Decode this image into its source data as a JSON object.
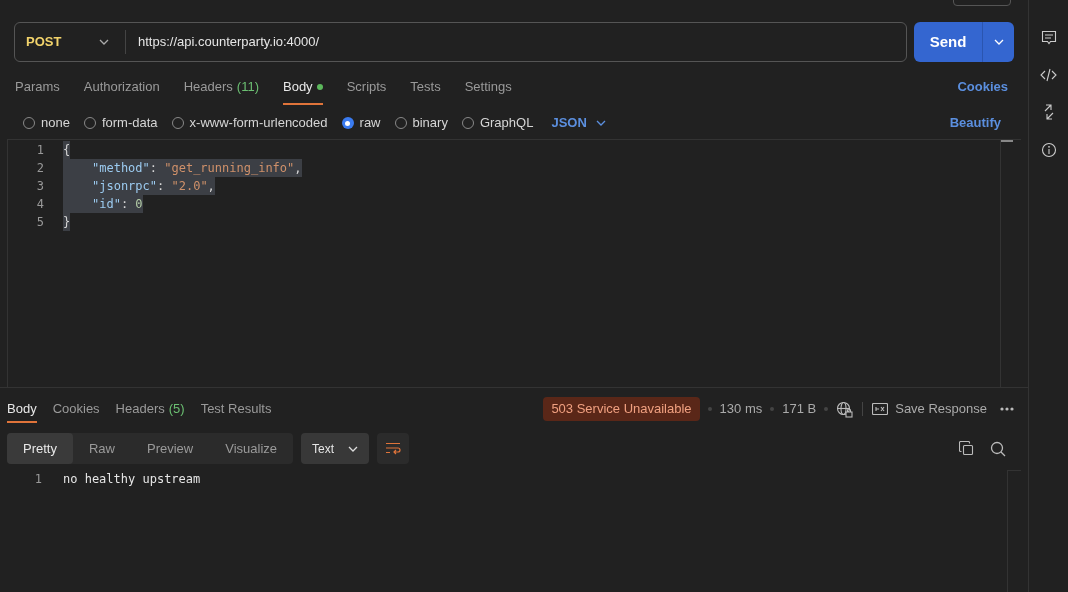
{
  "request": {
    "method": "POST",
    "url": "https://api.counterparty.io:4000/",
    "send_label": "Send"
  },
  "request_tabs": [
    {
      "label": "Params",
      "selected": false
    },
    {
      "label": "Authorization",
      "selected": false
    },
    {
      "label": "Headers",
      "count": "(11)",
      "selected": false
    },
    {
      "label": "Body",
      "dot": true,
      "selected": true
    },
    {
      "label": "Scripts",
      "selected": false
    },
    {
      "label": "Tests",
      "selected": false
    },
    {
      "label": "Settings",
      "selected": false
    }
  ],
  "cookies_link": "Cookies",
  "body_types": [
    {
      "label": "none",
      "selected": false
    },
    {
      "label": "form-data",
      "selected": false
    },
    {
      "label": "x-www-form-urlencoded",
      "selected": false
    },
    {
      "label": "raw",
      "selected": true
    },
    {
      "label": "binary",
      "selected": false
    },
    {
      "label": "GraphQL",
      "selected": false
    }
  ],
  "body_format": "JSON",
  "beautify_link": "Beautify",
  "code_lines": [
    {
      "number": "1",
      "selected": true,
      "tokens": [
        {
          "kind": "punct",
          "text": "{"
        }
      ],
      "children": [
        {
          "number": "2",
          "selected": true,
          "tokens": [
            {
              "kind": "key",
              "text": "\"method\""
            },
            {
              "kind": "punct",
              "text": ": "
            },
            {
              "kind": "string",
              "text": "\"get_running_info\""
            },
            {
              "kind": "punct",
              "text": ","
            }
          ]
        },
        {
          "number": "3",
          "selected": true,
          "tokens": [
            {
              "kind": "key",
              "text": "\"jsonrpc\""
            },
            {
              "kind": "punct",
              "text": ": "
            },
            {
              "kind": "string",
              "text": "\"2.0\""
            },
            {
              "kind": "punct",
              "text": ","
            }
          ]
        },
        {
          "number": "4",
          "selected": true,
          "tokens": [
            {
              "kind": "key",
              "text": "\"id\""
            },
            {
              "kind": "punct",
              "text": ": "
            },
            {
              "kind": "number",
              "text": "0"
            }
          ]
        }
      ]
    },
    {
      "number": "5",
      "selected": true,
      "tokens": [
        {
          "kind": "punct",
          "text": "}"
        }
      ]
    }
  ],
  "response": {
    "tabs": [
      {
        "label": "Body",
        "selected": true
      },
      {
        "label": "Cookies",
        "selected": false
      },
      {
        "label": "Headers",
        "count": "(5)",
        "selected": false
      },
      {
        "label": "Test Results",
        "selected": false
      }
    ],
    "status": "503 Service Unavailable",
    "time": "130 ms",
    "size": "171 B",
    "save_label": "Save Response",
    "view_modes": [
      {
        "label": "Pretty",
        "selected": true
      },
      {
        "label": "Raw",
        "selected": false
      },
      {
        "label": "Preview",
        "selected": false
      },
      {
        "label": "Visualize",
        "selected": false
      }
    ],
    "format": "Text",
    "lines": [
      {
        "number": "1",
        "text": "no healthy upstream"
      }
    ]
  }
}
